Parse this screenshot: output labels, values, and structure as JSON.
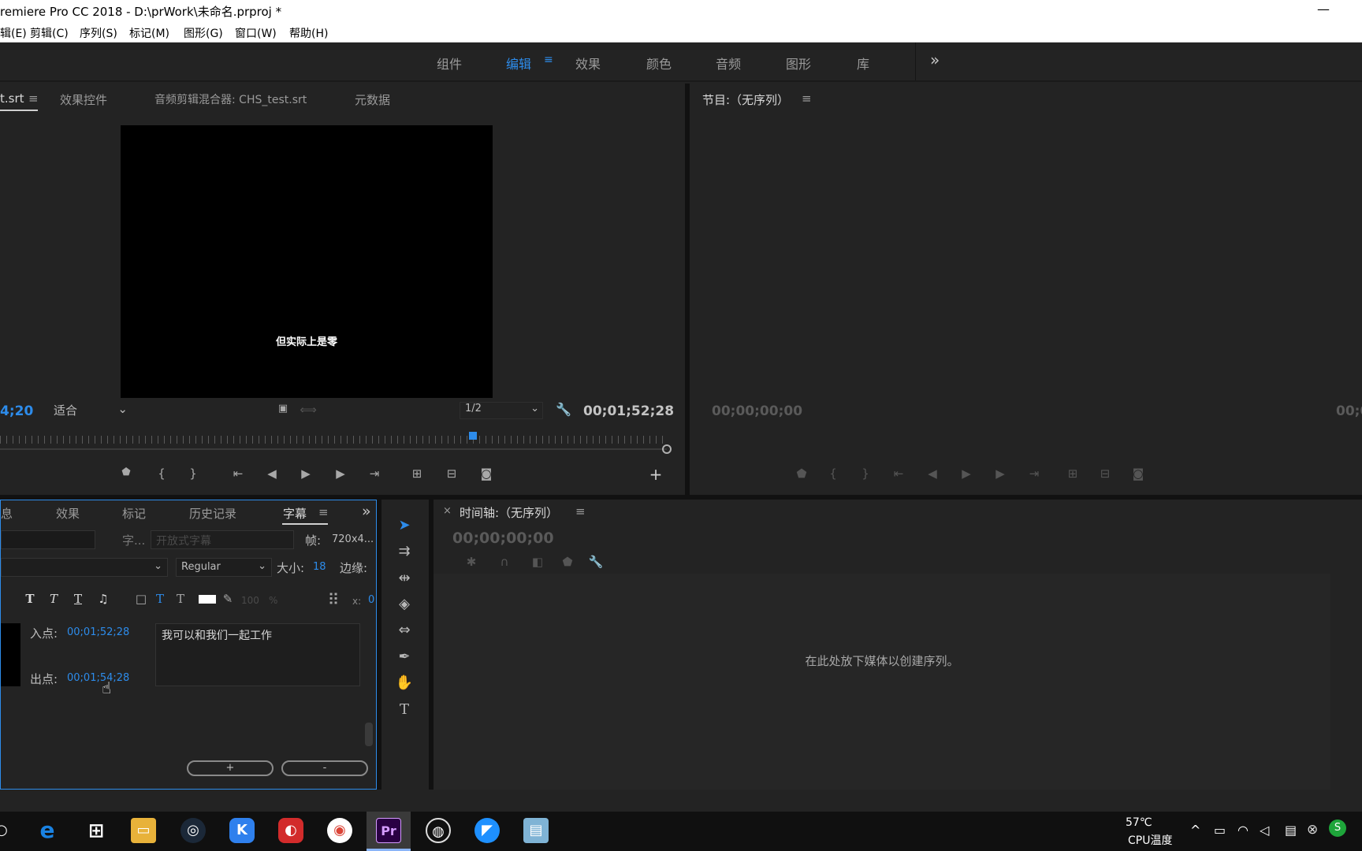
{
  "window": {
    "title": "remiere Pro CC 2018 - D:\\prWork\\未命名.prproj *",
    "minimize": "—"
  },
  "menu": [
    "辑(E)",
    "剪辑(C)",
    "序列(S)",
    "标记(M)",
    "图形(G)",
    "窗口(W)",
    "帮助(H)"
  ],
  "workspace": {
    "tabs": [
      "组件",
      "编辑",
      "效果",
      "颜色",
      "音频",
      "图形",
      "库"
    ],
    "active": "编辑",
    "more": "»"
  },
  "source": {
    "tabs": [
      "t.srt",
      "效果控件",
      "音频剪辑混合器: CHS_test.srt",
      "元数据"
    ],
    "caption_preview": "但实际上是零",
    "timecode_left": "4;20",
    "fit": "适合",
    "resolution": "1/2",
    "timecode_right": "00;01;52;28"
  },
  "program": {
    "title": "节目:（无序列）",
    "timecode_left": "00;00;00;00",
    "timecode_right": "00;0"
  },
  "captions_panel": {
    "tabs": [
      "息",
      "效果",
      "标记",
      "历史记录",
      "字幕"
    ],
    "style_label": "字...",
    "caption_type": "开放式字幕",
    "frame_label": "帧:",
    "frame_value": "720x4...",
    "font_style": "Regular",
    "size_label": "大小:",
    "size_value": "18",
    "edge_label": "边缘:",
    "opacity_value": "100",
    "opacity_unit": "%",
    "x_label": "x:",
    "x_value": "0",
    "in_label": "入点:",
    "in_value": "00;01;52;28",
    "out_label": "出点:",
    "out_value": "00;01;54;28",
    "caption_text": "我可以和我们一起工作",
    "add_button": "+",
    "remove_button": "-"
  },
  "timeline": {
    "title": "时间轴:（无序列）",
    "close": "×",
    "timecode": "00;00;00;00",
    "empty_msg": "在此处放下媒体以创建序列。"
  },
  "taskbar": {
    "temp": "57℃",
    "temp_label": "CPU温度"
  }
}
